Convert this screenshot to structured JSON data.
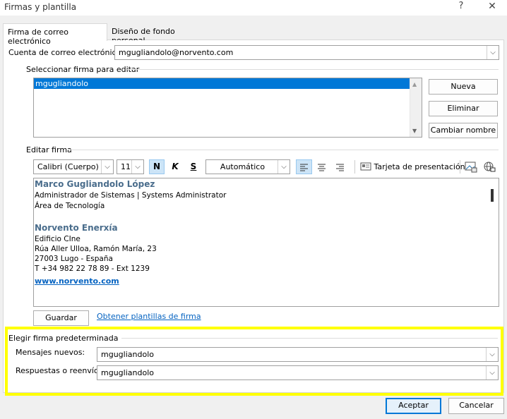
{
  "window": {
    "title": "Firmas y plantilla",
    "help_glyph": "?",
    "close_glyph": "✕"
  },
  "tabs": [
    {
      "label": "Firma de correo electrónico",
      "active": true
    },
    {
      "label": "Diseño de fondo personal",
      "active": false
    }
  ],
  "account": {
    "label": "Cuenta de correo electrónico:",
    "value": "mgugliandolo@norvento.com"
  },
  "select_signature": {
    "group_label": "Seleccionar firma para editar",
    "items": [
      "mgugliandolo"
    ],
    "selected_index": 0,
    "buttons": {
      "new": "Nueva",
      "delete": "Eliminar",
      "rename": "Cambiar nombre"
    }
  },
  "edit_signature": {
    "group_label": "Editar firma",
    "font_name": "Calibri (Cuerpo)",
    "font_size": "11",
    "bold": "N",
    "italic": "K",
    "underline": "S",
    "color": "Automático",
    "business_card": "Tarjeta de presentación",
    "content": {
      "name": "Marco Gugliandolo López",
      "role": "Administrador de Sistemas | Systems Administrator",
      "department": "Área de Tecnología",
      "company": "Norvento Enerxía",
      "building": "Edificio CIne",
      "street": "Rúa Aller Ulloa, Ramón María, 23",
      "city": "27003 Lugo - España",
      "phone": "T +34 982 22 78 89 - Ext 1239",
      "website": "www.norvento.com"
    },
    "save_button": "Guardar",
    "templates_link": "Obtener plantillas de firma"
  },
  "default_signature": {
    "group_label": "Elegir firma predeterminada",
    "new_messages_label": "Mensajes nuevos:",
    "new_messages_value": "mgugliandolo",
    "replies_label": "Respuestas o reenvíos:",
    "replies_value": "mgugliandolo",
    "highlight_color": "#ffff00"
  },
  "footer": {
    "ok": "Aceptar",
    "cancel": "Cancelar"
  },
  "colors": {
    "accent": "#0078d7",
    "signature_name": "#4a6d8c",
    "link": "#0563c1"
  }
}
